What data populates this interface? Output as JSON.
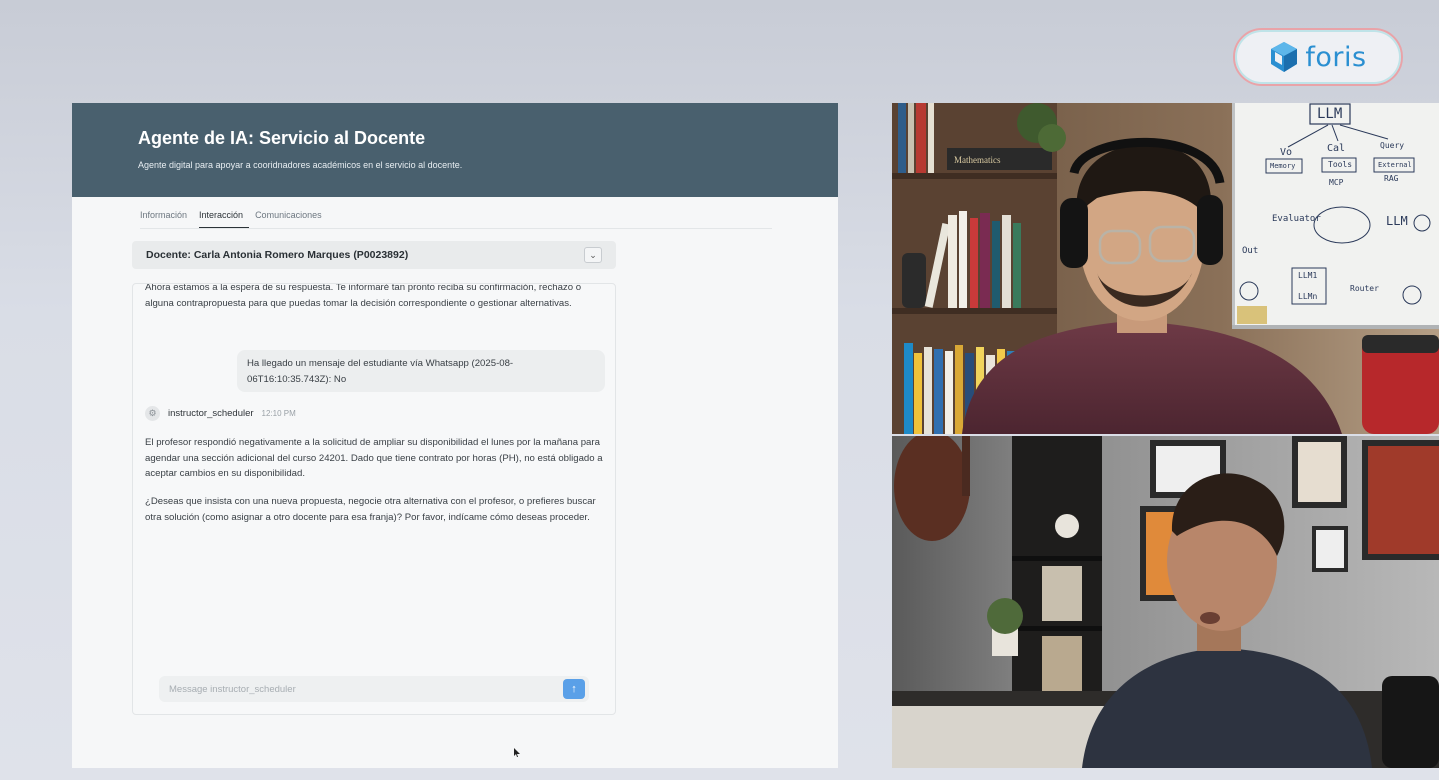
{
  "logo": {
    "text": "foris",
    "accent": "#2a8fd1"
  },
  "app": {
    "title": "Agente de IA: Servicio al Docente",
    "subtitle": "Agente digital para apoyar a cooridnadores académicos en el servicio al docente.",
    "header_color": "#49606e",
    "tabs": [
      {
        "label": "Información",
        "active": false
      },
      {
        "label": "Interacción",
        "active": true
      },
      {
        "label": "Comunicaciones",
        "active": false
      }
    ],
    "docente": "Docente: Carla Antonia Romero Marques (P0023892)",
    "chat": {
      "prev_text": "Ahora estamos a la espera de su respuesta. Te informaré tan pronto reciba su confirmación, rechazo o alguna contrapropuesta para que puedas tomar la decisión correspondiente o gestionar alternativas.",
      "user_message": "Ha llegado un mensaje del estudiante vía Whatsapp (2025-08-06T16:10:35.743Z): No",
      "agent_name": "instructor_scheduler",
      "agent_time": "12:10 PM",
      "agent_p1": "El profesor respondió negativamente a la solicitud de ampliar su disponibilidad el lunes por la mañana para agendar una sección adicional del curso 24201. Dado que tiene contrato por horas (PH), no está obligado a aceptar cambios en su disponibilidad.",
      "agent_p2": "¿Deseas que insista con una nueva propuesta, negocie otra alternativa con el profesor, o prefieres buscar otra solución (como asignar a otro docente para esa franja)? Por favor, indícame cómo deseas proceder.",
      "composer_placeholder": "Message instructor_scheduler",
      "send_color": "#5aa0e8"
    }
  },
  "video": {
    "whiteboard": {
      "top": "LLM",
      "left": "Vo",
      "mid_1": "Cal",
      "mid_2": "Query",
      "box_1": "Memory",
      "box_2": "Tools",
      "box_3": "External",
      "label_1": "MCP",
      "label_2": "RAG",
      "evaluator": "Evaluator",
      "llm_2": "LLM",
      "out": "Out",
      "llm_list": "LLM1",
      "llm_n": "LLMn",
      "router": "Router"
    },
    "book_spine": "Mathematics"
  }
}
